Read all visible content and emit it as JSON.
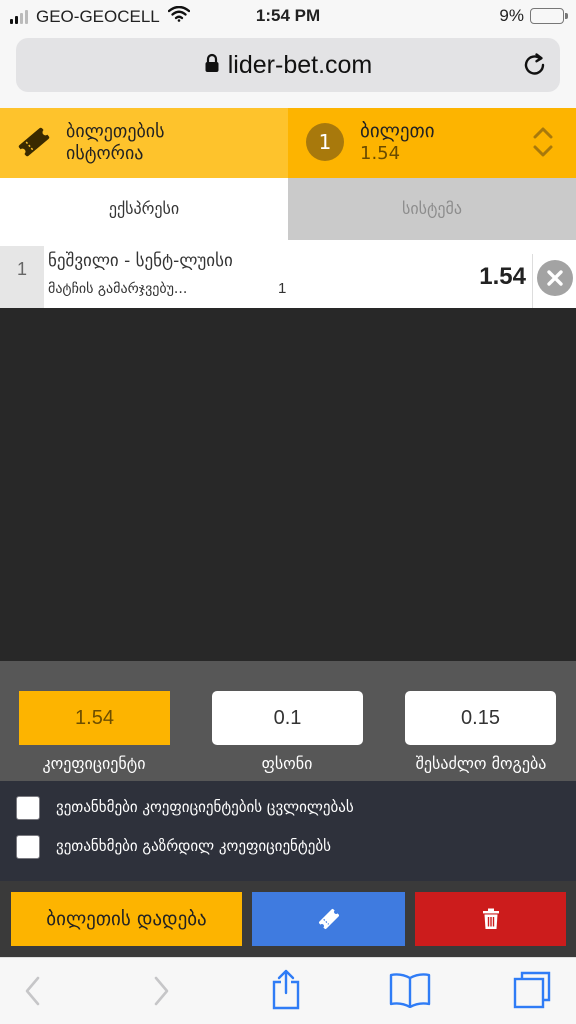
{
  "status_bar": {
    "carrier": "GEO-GEOCELL",
    "time": "1:54 PM",
    "battery_percent": "9%",
    "battery_level": 0.09,
    "signal_bars_filled": 2,
    "signal_bars_total": 4
  },
  "browser": {
    "url": "lider-bet.com",
    "lock_icon": "lock-icon",
    "reload_icon": "reload-icon"
  },
  "ticket_header": {
    "history_label_line1": "ბილეთების",
    "history_label_line2": "ისტორია",
    "ticket_count": "1",
    "ticket_label": "ბილეთი",
    "ticket_odds": "1.54"
  },
  "tabs": {
    "express": "ექსპრესი",
    "system": "სისტემა"
  },
  "bet": {
    "index": "1",
    "match": "ნეშვილი - სენტ-ლუისი",
    "market": "მატჩის გამარჯვებუ...",
    "outcome": "1",
    "odds": "1.54"
  },
  "stake_panel": {
    "odds_value": "1.54",
    "odds_label": "კოეფიციენტი",
    "stake_value": "0.1",
    "stake_label": "ფსონი",
    "win_value": "0.15",
    "win_label": "შესაძლო მოგება"
  },
  "agreements": {
    "accept_odds_change": "ვეთანხმები კოეფიციენტების ცვლილებას",
    "accept_increased_odds": "ვეთანხმები გაზრდილ კოეფიციენტებს"
  },
  "actions": {
    "place_bet": "ბილეთის დადება"
  },
  "colors": {
    "brand_yellow": "#fdb400",
    "history_yellow": "#fec32c",
    "share_blue": "#3f7be0",
    "delete_red": "#cc1c1c",
    "dark_bg": "#282828",
    "panel_gray": "#575757",
    "agree_bg": "#2e313b"
  }
}
